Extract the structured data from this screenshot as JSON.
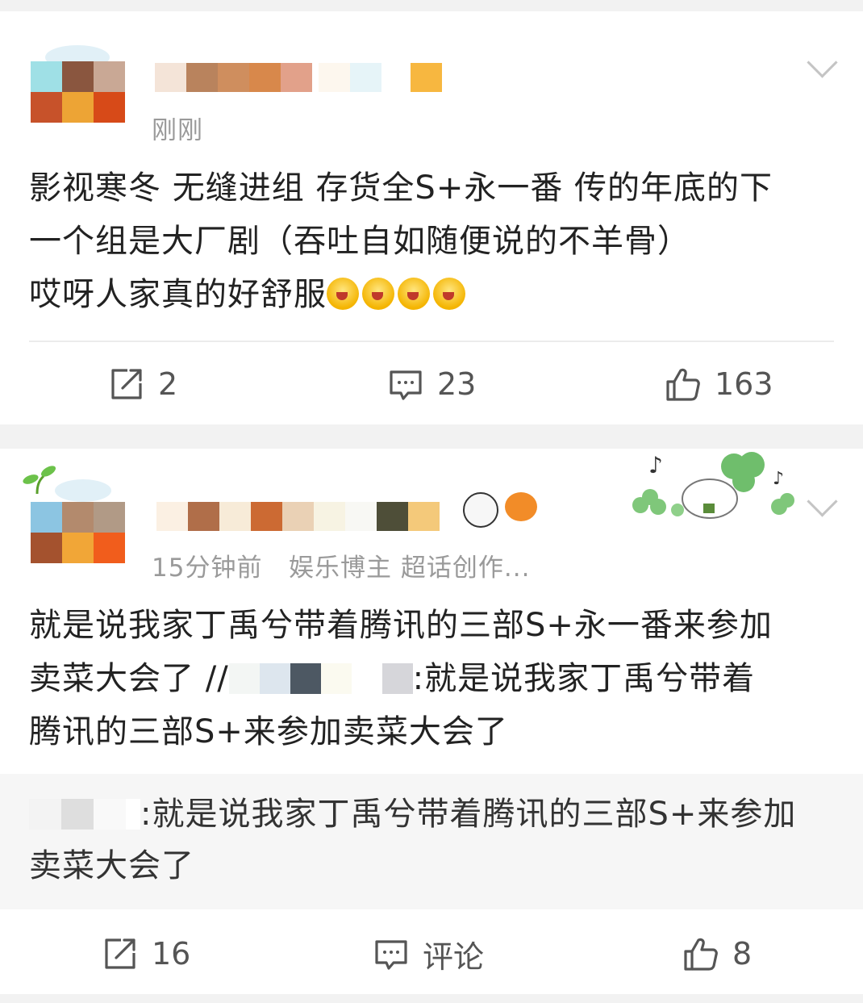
{
  "post1": {
    "time": "刚刚",
    "lines": [
      "影视寒冬 无缝进组 存货全S+永一番 传的年底的下",
      "一个组是大厂剧（吞吐自如随便说的不羊骨）",
      "哎呀人家真的好舒服"
    ],
    "emoji_count": 4,
    "actions": {
      "repost": "2",
      "comment": "23",
      "like": "163"
    }
  },
  "post2": {
    "time_and_tags": "15分钟前   娱乐博主 超话创作...",
    "lines": [
      "就是说我家丁禹兮带着腾讯的三部S+永一番来参加",
      "卖菜大会了 //",
      ":就是说我家丁禹兮带着",
      "腾讯的三部S+来参加卖菜大会了"
    ],
    "quote": {
      "line1": ":就是说我家丁禹兮带着腾讯的三部S+来参加",
      "line2": "卖菜大会了"
    },
    "actions": {
      "repost": "16",
      "comment": "评论",
      "like": "8"
    }
  },
  "colors": {
    "background": "#f2f2f2",
    "card": "#ffffff",
    "text": "#222222",
    "meta": "#9a9a9a",
    "icon": "#555555"
  },
  "icons": [
    "avatar",
    "chevron-down-icon",
    "repost-icon",
    "comment-icon",
    "like-icon",
    "laughing-emoji-icon",
    "panda-badge-icon",
    "fish-badge-icon",
    "clover-decoration"
  ]
}
